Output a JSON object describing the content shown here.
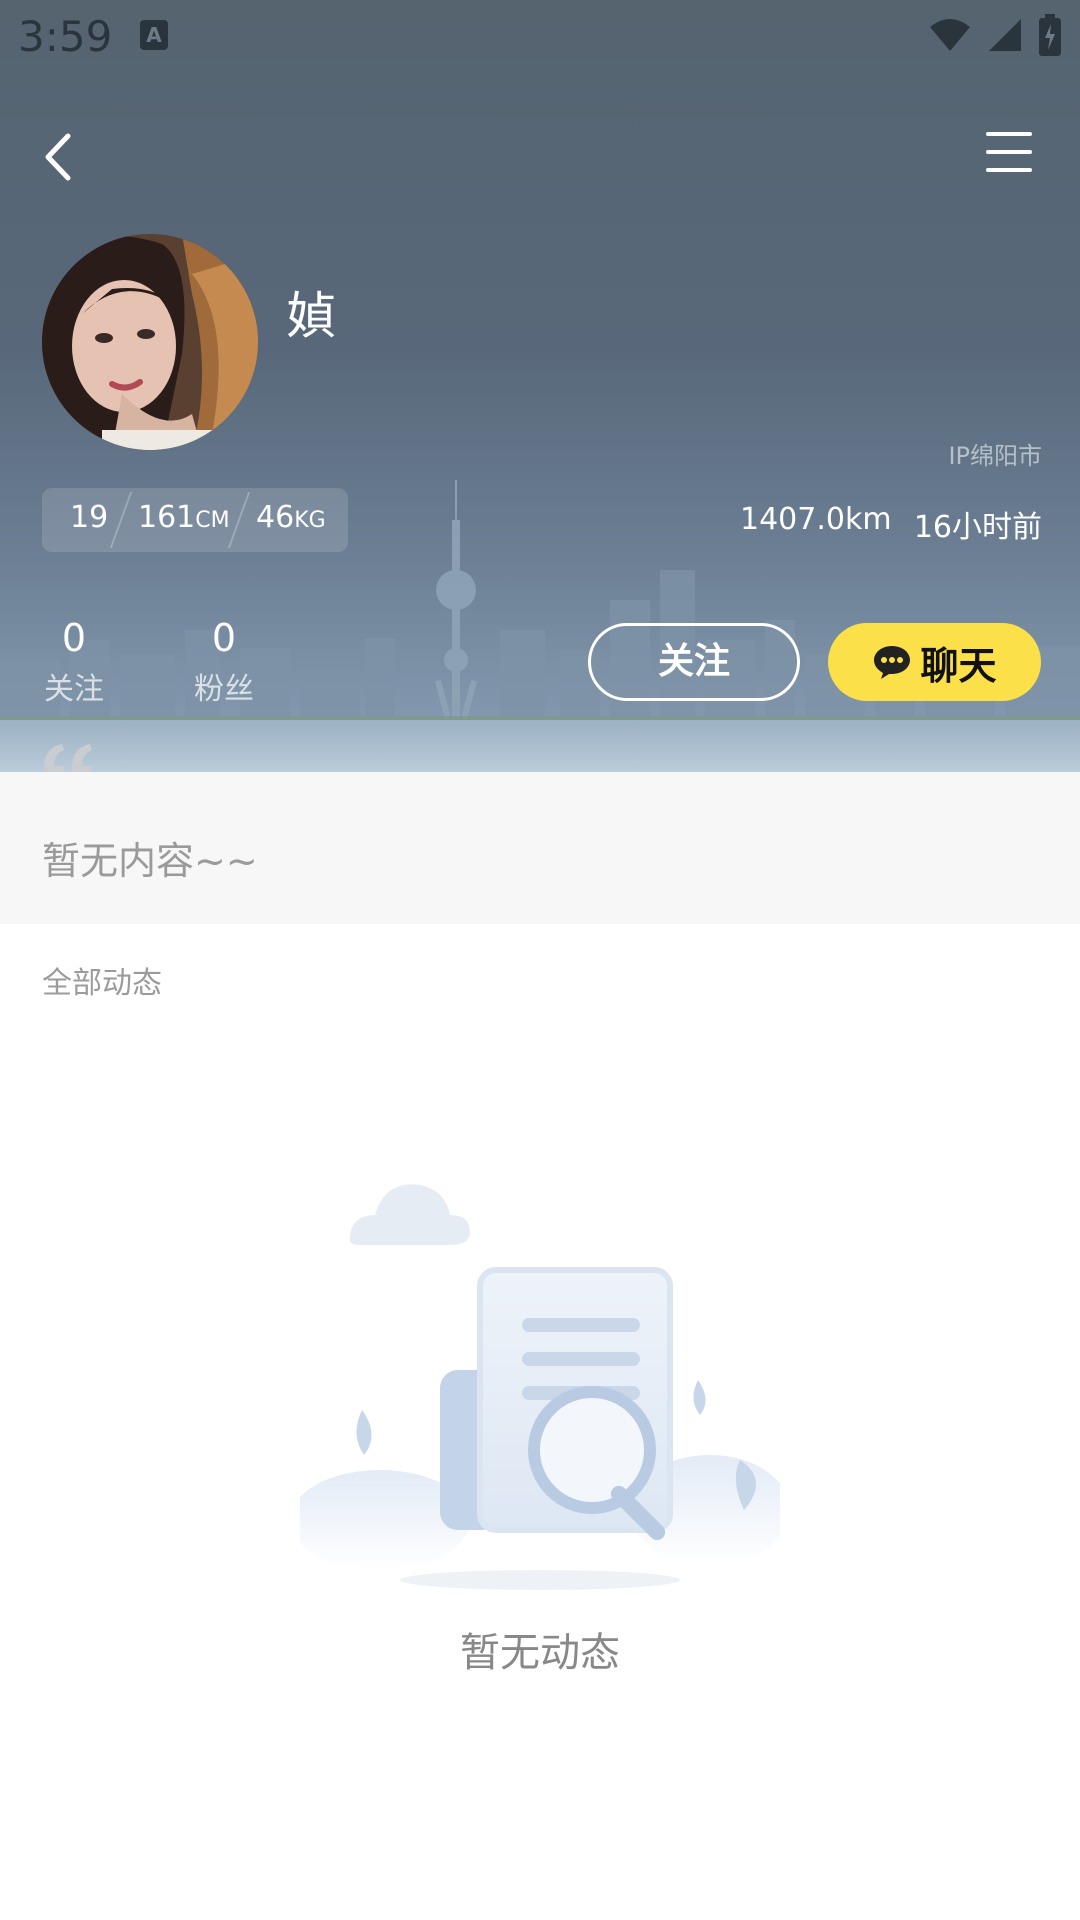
{
  "status_bar": {
    "time": "3:59",
    "notification_icon": "a-icon"
  },
  "toolbar": {
    "back_icon": "chevron-left-icon",
    "menu_icon": "hamburger-icon"
  },
  "profile": {
    "name": "媜",
    "ip_location": "IP绵阳市",
    "age": "19",
    "height_value": "161",
    "height_unit": "CM",
    "weight_value": "46",
    "weight_unit": "KG",
    "distance": "1407.0km",
    "last_active": "16小时前"
  },
  "counters": {
    "following_count": "0",
    "following_label": "关注",
    "fans_count": "0",
    "fans_label": "粉丝"
  },
  "actions": {
    "follow_label": "关注",
    "chat_label": "聊天"
  },
  "bio": {
    "text": "暂无内容~~"
  },
  "feed": {
    "section_title": "全部动态",
    "empty_text": "暂无动态"
  },
  "colors": {
    "chat_button": "#fbe04a",
    "header_bg": "#5a6a7a"
  }
}
